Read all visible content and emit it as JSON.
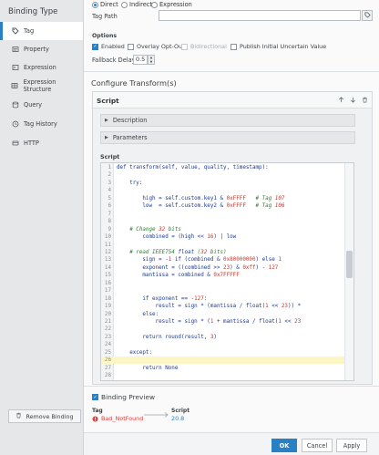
{
  "sidebar": {
    "title": "Binding Type",
    "items": [
      {
        "label": "Tag",
        "icon": "tag-icon"
      },
      {
        "label": "Property",
        "icon": "property-icon"
      },
      {
        "label": "Expression",
        "icon": "expression-icon"
      },
      {
        "label": "Expression Structure",
        "icon": "expression-structure-icon"
      },
      {
        "label": "Query",
        "icon": "query-icon"
      },
      {
        "label": "Tag History",
        "icon": "history-icon"
      },
      {
        "label": "HTTP",
        "icon": "http-icon"
      }
    ],
    "remove_label": "Remove Binding"
  },
  "tag": {
    "modes": [
      "Direct",
      "Indirect",
      "Expression"
    ],
    "tag_path_label": "Tag Path",
    "tag_path_value": "",
    "options_label": "Options",
    "options": [
      {
        "label": "Enabled",
        "checked": true,
        "disabled": false
      },
      {
        "label": "Overlay Opt-Out",
        "checked": false,
        "disabled": false
      },
      {
        "label": "Bidirectional",
        "checked": false,
        "disabled": true
      },
      {
        "label": "Publish Initial Uncertain Value",
        "checked": false,
        "disabled": false
      }
    ],
    "fallback_label": "Fallback Delay",
    "fallback_value": "0.5"
  },
  "transforms": {
    "title": "Configure Transform(s)",
    "panel_title": "Script",
    "description_label": "Description",
    "parameters_label": "Parameters",
    "script_label": "Script"
  },
  "code": [
    "def transform(self, value, quality, timestamp):",
    "",
    "    try:",
    "",
    "        high = self.custom.key1 & 0xFFFF   # Tag 107",
    "        low  = self.custom.key2 & 0xFFFF   # Tag 106",
    "",
    "",
    "    # Change 32 bits",
    "        combined = (high << 16) | low",
    "",
    "    # read IEEE754 float (32 bits)",
    "        sign = -1 if (combined & 0x80000000) else 1",
    "        exponent = ((combined >> 23) & 0xff) - 127",
    "        mantissa = combined & 0x7FFFFF",
    "",
    "",
    "        if exponent == -127:",
    "            result = sign * (mantissa / float(1 << 23)) *",
    "        else:",
    "            result = sign * (1 + mantissa / float(1 << 23",
    "",
    "        return round(result, 3)",
    "",
    "    except:",
    "",
    "        return None",
    ""
  ],
  "preview": {
    "title": "Binding Preview",
    "tag_header": "Tag",
    "tag_value": "Bad_NotFound",
    "script_header": "Script",
    "script_value": "20.8"
  },
  "footer": {
    "ok": "OK",
    "cancel": "Cancel",
    "apply": "Apply"
  },
  "colors": {
    "accent": "#2a80c5",
    "error": "#d64541",
    "highlight_line": "#fbf6c4"
  }
}
